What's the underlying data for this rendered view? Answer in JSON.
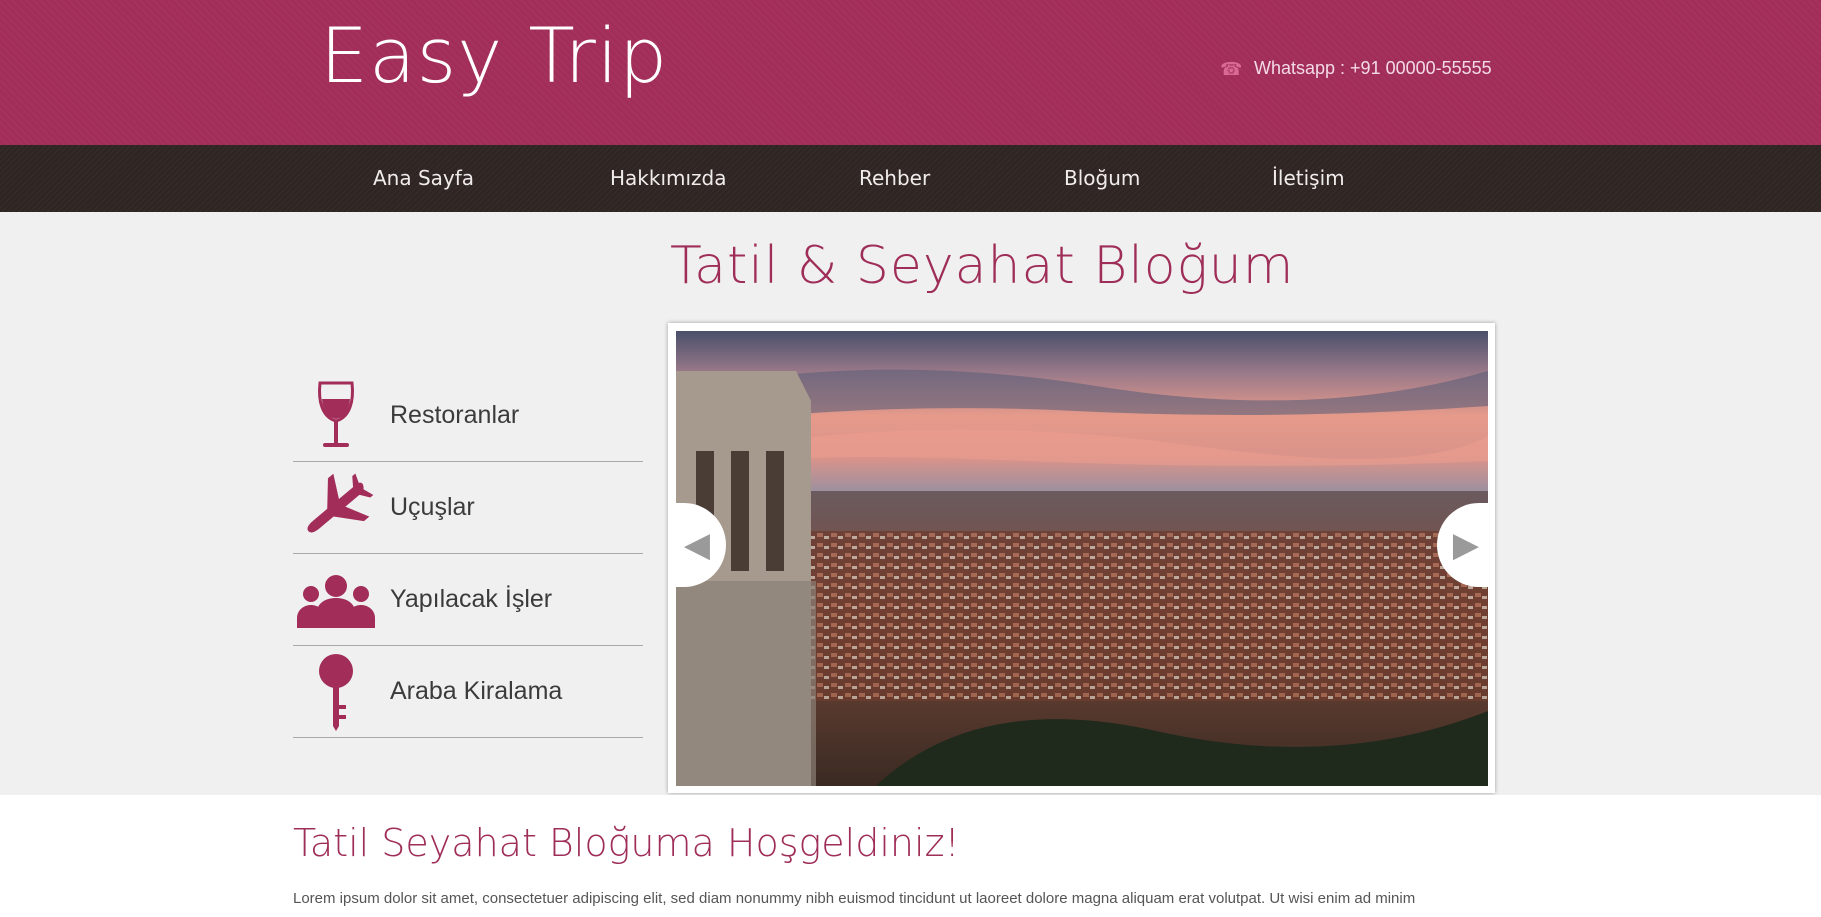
{
  "header": {
    "logo": "Easy Trip",
    "contact": "Whatsapp : +91 00000-55555"
  },
  "nav": [
    {
      "label": "Ana Sayfa"
    },
    {
      "label": "Hakkımızda"
    },
    {
      "label": "Rehber"
    },
    {
      "label": "Bloğum"
    },
    {
      "label": "İletişim"
    }
  ],
  "page_title": "Tatil & Seyahat Bloğum",
  "categories": [
    {
      "label": "Restoranlar",
      "icon": "wine-glass-icon"
    },
    {
      "label": "Uçuşlar",
      "icon": "airplane-icon"
    },
    {
      "label": "Yapılacak İşler",
      "icon": "people-icon"
    },
    {
      "label": "Araba Kiralama",
      "icon": "key-icon"
    }
  ],
  "slider": {
    "image": "city-sunset-photo"
  },
  "content": {
    "welcome": "Tatil Seyahat Bloğuma Hoşgeldiniz!",
    "text": "Lorem ipsum dolor sit amet, consectetuer adipiscing elit, sed diam nonummy nibh euismod tincidunt ut laoreet dolore magna aliquam erat volutpat. Ut wisi enim ad minim"
  },
  "colors": {
    "brand": "#a12d58",
    "nav_bg": "#2f2624",
    "title": "#9e2d57"
  }
}
